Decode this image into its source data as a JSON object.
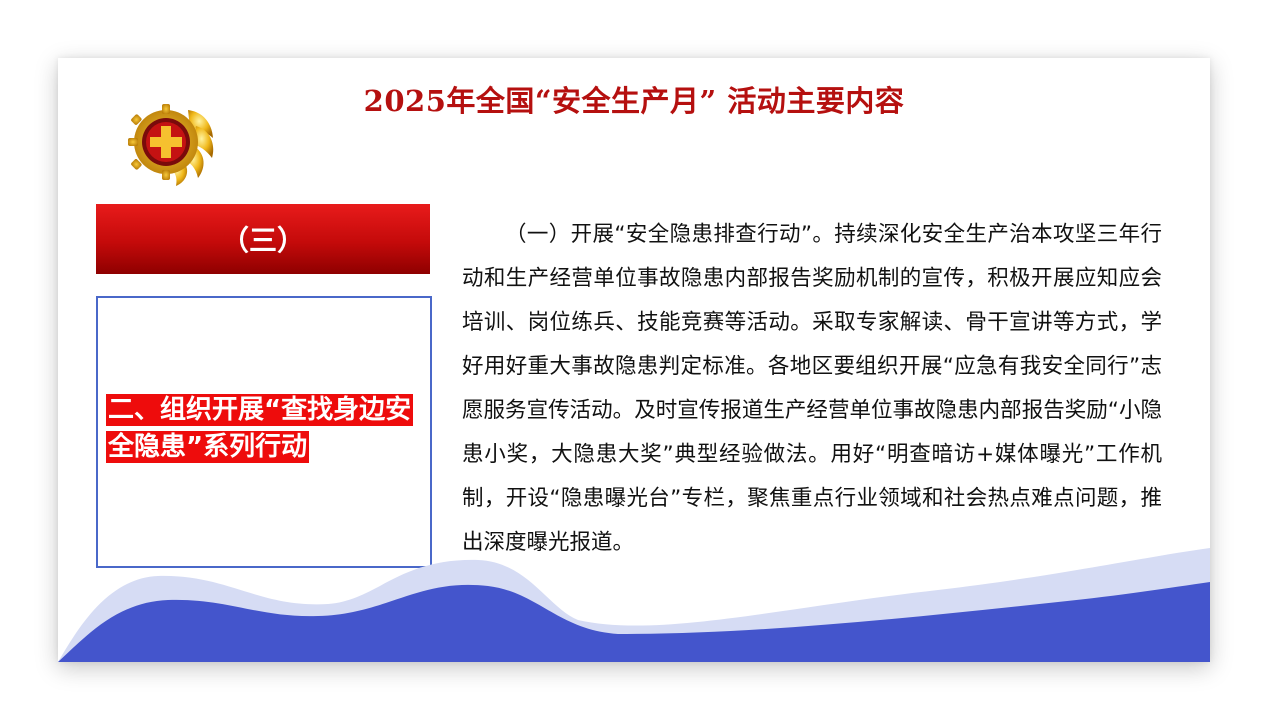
{
  "slide": {
    "title": "2025年全国“安全生产月” 活动主要内容",
    "section_tag": "（三）",
    "topic": "二、组织开展“查找身边安全隐患”系列行动",
    "body": "（一）开展“安全隐患排查行动”。持续深化安全生产治本攻坚三年行动和生产经营单位事故隐患内部报告奖励机制的宣传，积极开展应知应会培训、岗位练兵、技能竞赛等活动。采取专家解读、骨干宣讲等方式，学好用好重大事故隐患判定标准。各地区要组织开展“应急有我安全同行”志愿服务宣传活动。及时宣传报道生产经营单位事故隐患内部报告奖励“小隐患小奖，大隐患大奖”典型经验做法。用好“明查暗访+媒体曝光”工作机制，开设“隐患曝光台”专栏，聚焦重点行业领域和社会热点难点问题，推出深度曝光报道。"
  },
  "icons": {
    "emblem": "safety-production-emblem-icon"
  },
  "colors": {
    "title": "#b5100f",
    "tag_red": "#c40a0a",
    "topic_highlight": "#ee0c0c",
    "box_border": "#4a68c9",
    "wave_dark": "#4455cc",
    "wave_light": "#d6dcf4"
  }
}
